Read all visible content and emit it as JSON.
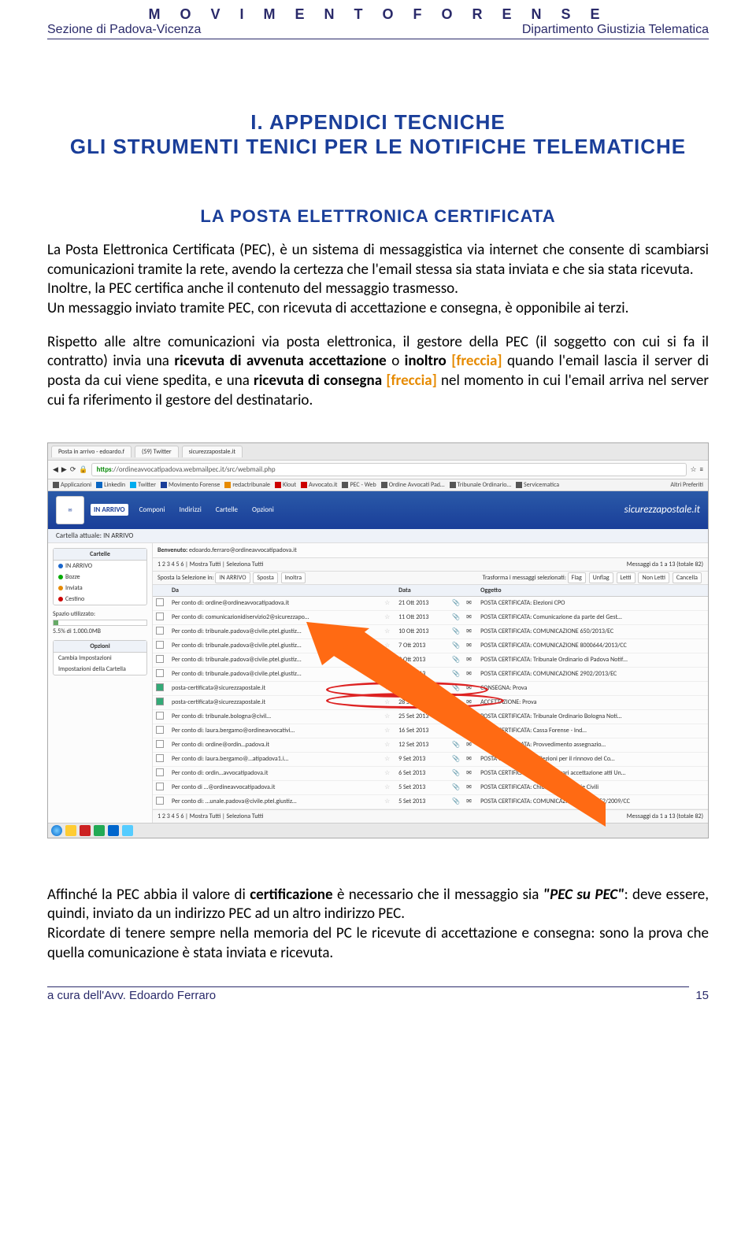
{
  "header": {
    "org": "M O V I M E N T O   F O R E N S E",
    "left": "Sezione di Padova-Vicenza",
    "right": "Dipartimento Giustizia Telematica"
  },
  "titles": {
    "appendix1": "I. APPENDICI TECNICHE",
    "appendix2": "GLI STRUMENTI TENICI PER LE NOTIFICHE TELEMATICHE",
    "section": "LA POSTA ELETTRONICA CERTIFICATA"
  },
  "para1": {
    "p1": "La Posta Elettronica Certificata (PEC), è un sistema di messaggistica via internet che consente di scambiarsi comunicazioni tramite la rete, avendo la certezza che l'email stessa sia stata inviata e che sia stata ricevuta.",
    "p2": "Inoltre, la PEC certifica anche il contenuto del messaggio trasmesso.",
    "p3": "Un messaggio inviato tramite PEC, con ricevuta di accettazione e consegna, è opponibile ai terzi."
  },
  "para2": {
    "a": "Rispetto alle altre comunicazioni via posta elettronica, il gestore della PEC (il soggetto con cui si fa il contratto) invia una ",
    "b": "ricevuta di avvenuta accettazione",
    "c": " o ",
    "d": "inoltro",
    "e": " ",
    "f": "[freccia]",
    "g": " quando l'email lascia il server di posta da cui viene spedita, e una ",
    "h": "ricevuta di consegna",
    "i": " ",
    "j": "[freccia]",
    "k": " nel momento in cui l'email arriva nel server cui fa riferimento il gestore del destinatario."
  },
  "browser": {
    "tabs": [
      "Posta in arrivo - edoardo.f",
      "(59) Twitter",
      "sicurezzapostale.it"
    ],
    "url_prefix": "https",
    "url": "://ordineavvocatipadova.webmailpec.it/src/webmail.php",
    "bookmarks": [
      "Applicazioni",
      "Linkedin",
      "Twitter",
      "Movimento Forense",
      "redactribunale",
      "Klout",
      "Avvocato.it",
      "PEC - Web",
      "Ordine Avvocati Pad…",
      "Tribunale Ordinario…",
      "Servicematica",
      "Altri Preferiti"
    ],
    "banner_nav": [
      "IN ARRIVO",
      "Componi",
      "Indirizzi",
      "Cartelle",
      "Opzioni"
    ],
    "brand": "sicurezzapostale.it",
    "crumb": "Cartella attuale: IN ARRIVO",
    "side_folders_title": "Cartelle",
    "side_folders": [
      "IN ARRIVO",
      "Bozze",
      "Inviata",
      "Cestino"
    ],
    "space_label": "Spazio utilizzato:",
    "space_val": "5.5% di 1.000.0MB",
    "side_opts_title": "Opzioni",
    "side_opts": [
      "Cambia Impostazioni",
      "Impostazioni della Cartella"
    ],
    "welcome_label": "Benvenuto:",
    "welcome_val": "edoardo.ferraro@ordineavvocatipadova.it",
    "pager_top": "1 2 3 4 5 6 | Mostra Tutti | Seleziona Tutti",
    "msgs_count": "Messaggi da 1 a 13 (totale 82)",
    "sel_label": "Sposta la Selezione in:",
    "sel_dest": "IN ARRIVO",
    "sel_btn1": "Sposta",
    "sel_btn2": "Inoltra",
    "sel_right_label": "Trasforma i messaggi selezionati:",
    "sel_flags": [
      "Flag",
      "Unflag",
      "Letti",
      "Non Letti",
      "Cancella"
    ],
    "cols": [
      "",
      "Da",
      "",
      "Data",
      "",
      "",
      "Oggetto"
    ],
    "rows": [
      {
        "from": "Per conto di: ordine@ordineavvocatipadova.it",
        "date": "21 Ott 2013",
        "subj": "POSTA CERTIFICATA: Elezioni CPO"
      },
      {
        "from": "Per conto di: comunicazionidiservizio2@sicurezzapo…",
        "date": "11 Ott 2013",
        "subj": "POSTA CERTIFICATA: Comunicazione da parte del Gest…"
      },
      {
        "from": "Per conto di: tribunale.padova@civile.ptel.giustiz…",
        "date": "10 Ott 2013",
        "subj": "POSTA CERTIFICATA: COMUNICAZIONE 650/2013/EC"
      },
      {
        "from": "Per conto di: tribunale.padova@civile.ptel.giustiz…",
        "date": "7 Ott 2013",
        "subj": "POSTA CERTIFICATA: COMUNICAZIONE 8000644/2013/CC"
      },
      {
        "from": "Per conto di: tribunale.padova@civile.ptel.giustiz…",
        "date": "2 Ott 2013",
        "subj": "POSTA CERTIFICATA: Tribunale Ordinario di Padova Notif…"
      },
      {
        "from": "Per conto di: tribunale.padova@civile.ptel.giustiz…",
        "date": "2 Ott 2013",
        "subj": "POSTA CERTIFICATA: COMUNICAZIONE 2902/2013/EC"
      },
      {
        "from": "posta-certificata@sicurezzapostale.it",
        "date": "28 Set 2013",
        "subj": "CONSEGNA: Prova",
        "hl": true,
        "chk": true
      },
      {
        "from": "posta-certificata@sicurezzapostale.it",
        "date": "28 Set 2013",
        "subj": "ACCETTAZIONE: Prova",
        "hl": true,
        "chk": true
      },
      {
        "from": "Per conto di: tribunale.bologna@civil…",
        "date": "25 Set 2013",
        "subj": "POSTA CERTIFICATA: Tribunale Ordinario Bologna Noti…"
      },
      {
        "from": "Per conto di: laura.bergamo@ordineavvocativi…",
        "date": "16 Set 2013",
        "subj": "POSTA CERTIFICATA: Cassa Forense - Ind…"
      },
      {
        "from": "Per conto di: ordine@ordin…padova.it",
        "date": "12 Set 2013",
        "subj": "POSTA CERTIFICATA: Provvedimento assegnazio…"
      },
      {
        "from": "Per conto di: laura.bergamo@…atipadova1.i…",
        "date": "9 Set 2013",
        "subj": "POSTA CERTIFICATA: I: Elezioni per il rinnovo del Co…"
      },
      {
        "from": "Per conto di: ordin…avvocatipadova.it",
        "date": "6 Set 2013",
        "subj": "POSTA CERTIFICATA: Modifica orari accettazione atti Un…"
      },
      {
        "from": "Per conto di …@ordineavvocatipadova.it",
        "date": "5 Set 2013",
        "subj": "POSTA CERTIFICATA: Chiusura Cancellerie Civili"
      },
      {
        "from": "Per conto di: …unale.padova@civile.ptel.giustiz…",
        "date": "5 Set 2013",
        "subj": "POSTA CERTIFICATA: COMUNICAZIONE 80080552/2009/CC"
      }
    ],
    "pager_bot": "1 2 3 4 5 6 | Mostra Tutti | Seleziona Tutti"
  },
  "para3": {
    "a": "Affinché la PEC abbia il valore di ",
    "b": "certificazione",
    "c": " è necessario che il messaggio sia ",
    "d": "\"PEC su PEC\"",
    "e": ": deve essere, quindi, inviato da un indirizzo PEC ad un altro indirizzo PEC.",
    "f": "Ricordate di tenere sempre nella memoria del PC le ricevute di accettazione e consegna: sono la prova che quella comunicazione è stata inviata e ricevuta."
  },
  "footer": {
    "author": "a cura dell'Avv. Edoardo Ferraro",
    "page": "15"
  }
}
